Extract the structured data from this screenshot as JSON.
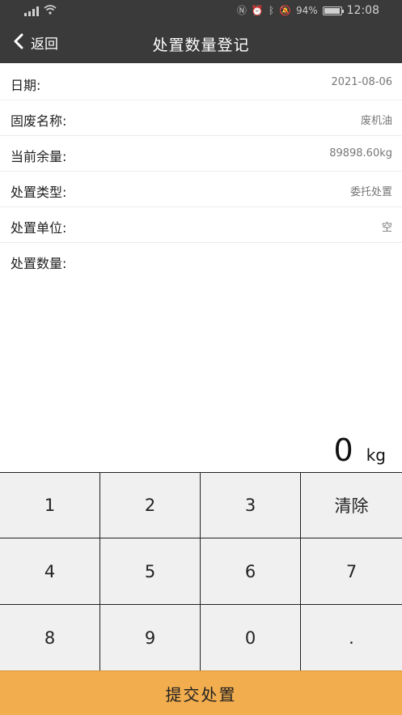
{
  "status_bar": {
    "battery_percent": "94%",
    "time": "12:08",
    "battery_level": 0.94
  },
  "nav": {
    "back_label": "返回",
    "title": "处置数量登记"
  },
  "form": {
    "rows": [
      {
        "label": "日期:",
        "value": "2021-08-06"
      },
      {
        "label": "固废名称:",
        "value": "废机油"
      },
      {
        "label": "当前余量:",
        "value": "89898.60kg"
      },
      {
        "label": "处置类型:",
        "value": "委托处置"
      },
      {
        "label": "处置单位:",
        "value": "空"
      },
      {
        "label": "处置数量:",
        "value": ""
      }
    ]
  },
  "quantity": {
    "value": "0",
    "unit": "kg"
  },
  "keypad": {
    "keys": [
      "1",
      "2",
      "3",
      "清除",
      "4",
      "5",
      "6",
      "7",
      "8",
      "9",
      "0",
      "."
    ]
  },
  "submit_label": "提交处置",
  "colors": {
    "header_bg": "#3a3a3a",
    "submit_bg": "#f2ad4e",
    "keypad_bg": "#f0f0f0"
  }
}
